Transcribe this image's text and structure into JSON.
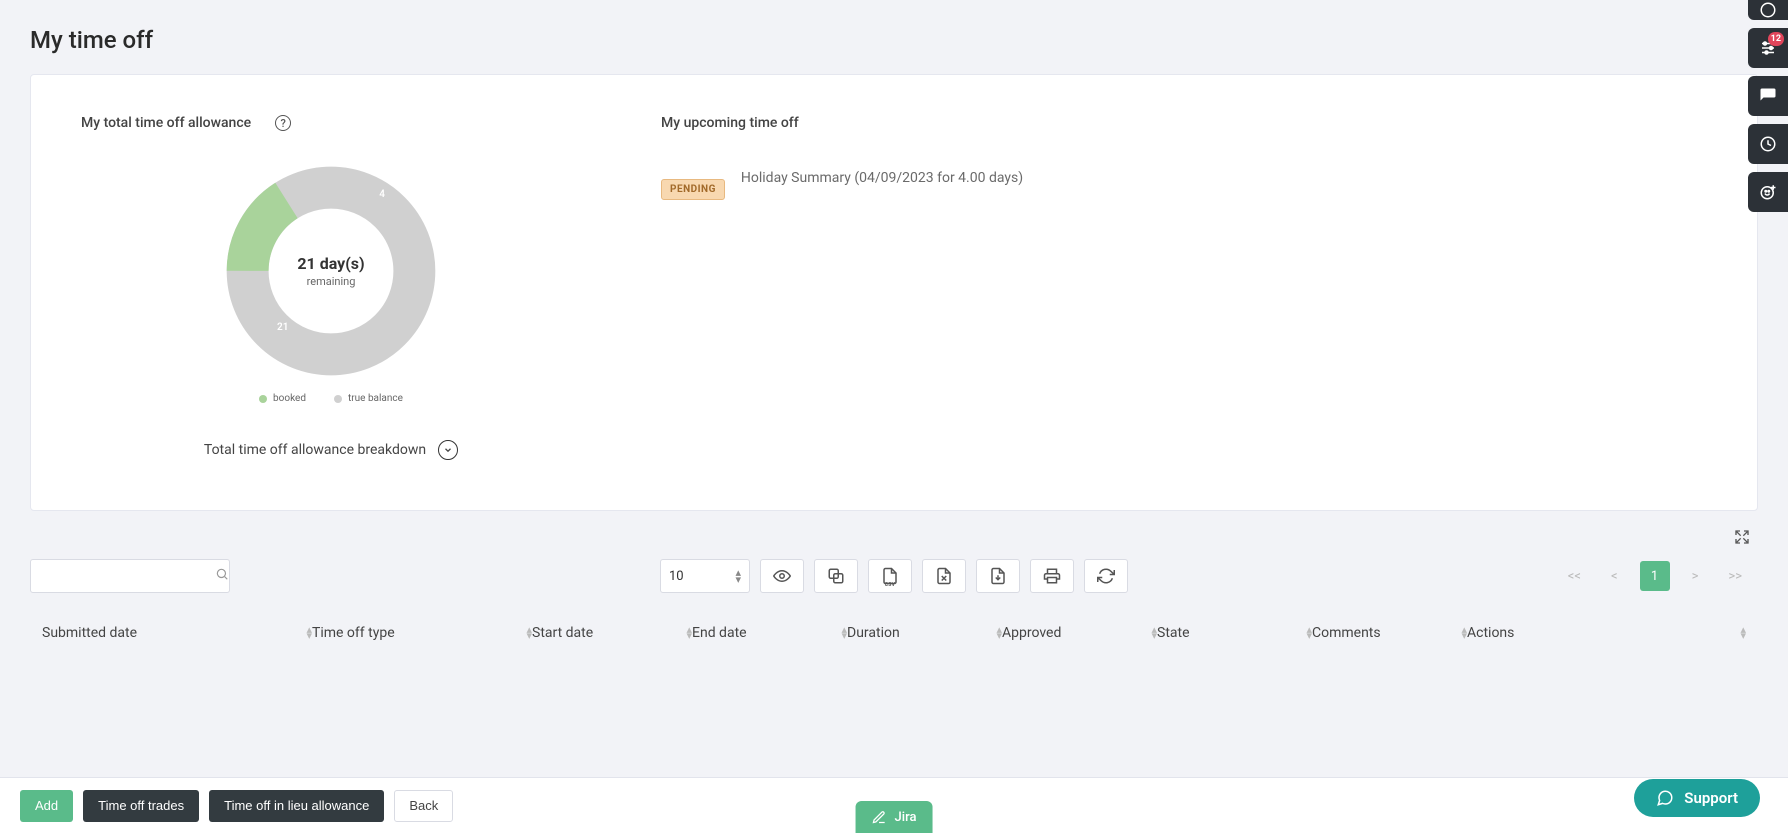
{
  "page": {
    "title": "My time off"
  },
  "allowance": {
    "title": "My total time off allowance",
    "remaining_value": "21 day(s)",
    "remaining_label": "remaining",
    "legend_booked": "booked",
    "legend_balance": "true balance",
    "breakdown_label": "Total time off allowance breakdown"
  },
  "upcoming": {
    "title": "My upcoming time off",
    "items": [
      {
        "status": "PENDING",
        "text": "Holiday Summary (04/09/2023 for 4.00 days)"
      }
    ]
  },
  "toolbar": {
    "page_size": "10",
    "pagination_first": "<<",
    "pagination_prev": "<",
    "pagination_current": "1",
    "pagination_next": ">",
    "pagination_last": ">>"
  },
  "table": {
    "columns": {
      "submitted": "Submitted date",
      "type": "Time off type",
      "start": "Start date",
      "end": "End date",
      "duration": "Duration",
      "approved": "Approved",
      "state": "State",
      "comments": "Comments",
      "actions": "Actions"
    }
  },
  "footer": {
    "add": "Add",
    "trades": "Time off trades",
    "lieu": "Time off in lieu allowance",
    "back": "Back",
    "jira": "Jira",
    "support": "Support"
  },
  "side": {
    "badge": "12"
  },
  "chart_data": {
    "type": "pie",
    "title": "My total time off allowance",
    "series": [
      {
        "name": "booked",
        "value": 4,
        "color": "#a9d39b"
      },
      {
        "name": "true balance",
        "value": 21,
        "color": "#d0d0d0"
      }
    ],
    "booked_label": "4",
    "balance_label": "21"
  }
}
